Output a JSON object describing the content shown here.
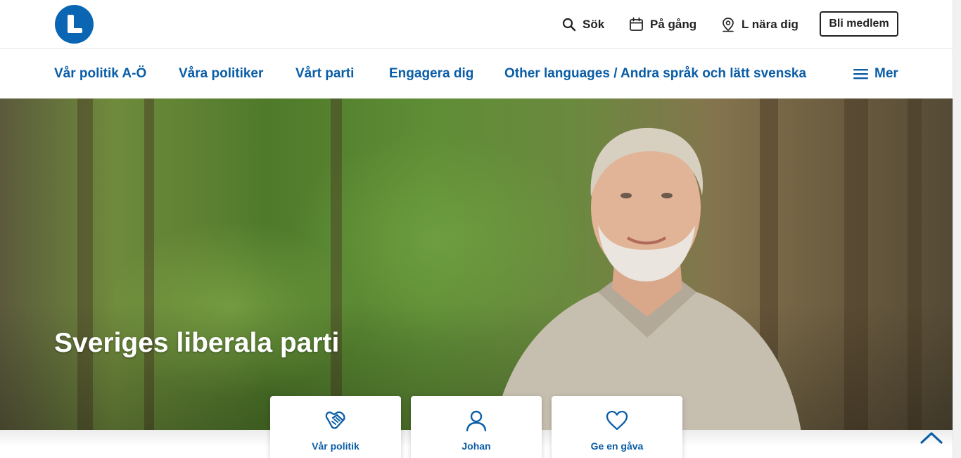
{
  "header": {
    "logo_alt": "L",
    "search_label": "Sök",
    "events_label": "På gång",
    "near_label": "L nära dig",
    "member_button": "Bli medlem"
  },
  "nav": {
    "items": [
      {
        "label": "Vår politik A-Ö"
      },
      {
        "label": "Våra politiker"
      },
      {
        "label": "Vårt parti"
      },
      {
        "label": "Engagera dig"
      },
      {
        "label": "Other languages / Andra språk och lätt svenska"
      }
    ],
    "more_label": "Mer"
  },
  "hero": {
    "title": "Sveriges liberala parti"
  },
  "cards": [
    {
      "label": "Vår politik",
      "icon": "handshake-icon"
    },
    {
      "label": "Johan",
      "icon": "user-icon"
    },
    {
      "label": "Ge en gåva",
      "icon": "heart-icon"
    }
  ],
  "colors": {
    "brand_blue": "#0a66b3",
    "nav_blue": "#0a5da6",
    "text_dark": "#222222"
  }
}
